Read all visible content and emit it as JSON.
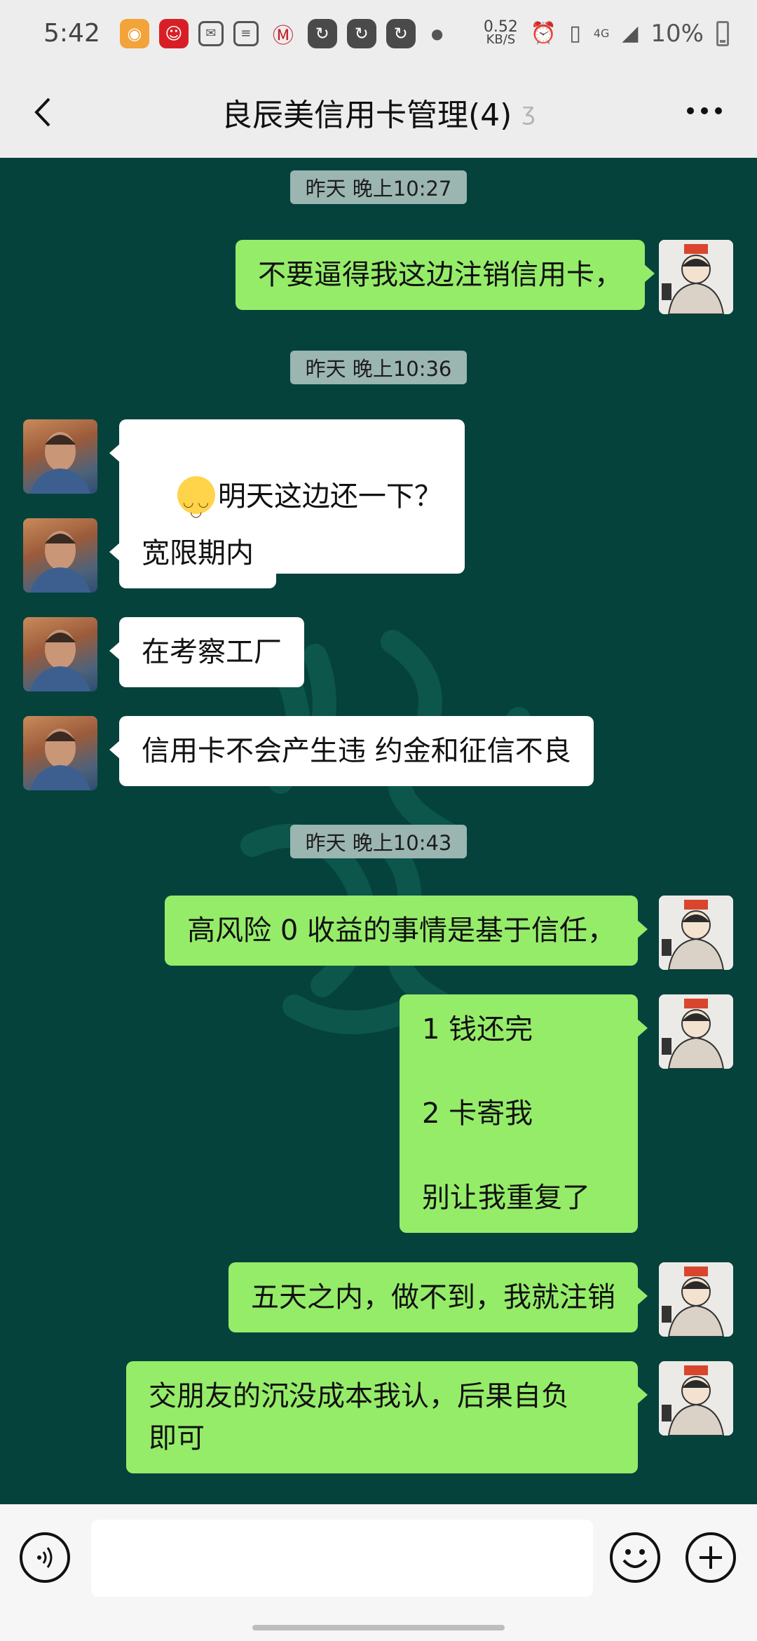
{
  "status_bar": {
    "time": "5:42",
    "speed_value": "0.52",
    "speed_unit": "KB/S",
    "network": "4G",
    "battery": "10%",
    "icons": [
      "weibo-icon",
      "app-red-icon",
      "mail-icon",
      "document-icon",
      "bank-icon",
      "refresh-icon",
      "refresh-icon",
      "refresh-icon",
      "alarm-icon",
      "vibrate-icon",
      "signal-icon",
      "battery-icon"
    ]
  },
  "header": {
    "title": "良辰美信用卡管理(4)",
    "icons": [
      "back-icon",
      "ear-icon",
      "more-icon"
    ]
  },
  "chat": {
    "timestamps": [
      "昨天 晚上10:27",
      "昨天 晚上10:36",
      "昨天 晚上10:43"
    ],
    "messages": [
      {
        "sender": "me",
        "text": "不要逼得我这边注销信用卡，"
      },
      {
        "sender": "them",
        "text": "明天这边还一下？",
        "emoji": "smile-emoji"
      },
      {
        "sender": "them",
        "text": "宽限期内"
      },
      {
        "sender": "them",
        "text": "在考察工厂"
      },
      {
        "sender": "them",
        "text": "信用卡不会产生违 约金和征信不良"
      },
      {
        "sender": "me",
        "text": "高风险 0 收益的事情是基于信任，"
      },
      {
        "sender": "me",
        "text": "1 钱还完\n\n2 卡寄我\n\n别让我重复了"
      },
      {
        "sender": "me",
        "text": "五天之内，做不到，我就注销"
      },
      {
        "sender": "me",
        "text": "交朋友的沉没成本我认，后果自负\n即可"
      }
    ]
  },
  "input_bar": {
    "placeholder": "",
    "icons": [
      "voice-icon",
      "emoji-icon",
      "plus-icon"
    ]
  },
  "colors": {
    "chat_background": "#05423c",
    "my_bubble": "#95ec69",
    "their_bubble": "#ffffff",
    "header_bg": "#ededed"
  }
}
